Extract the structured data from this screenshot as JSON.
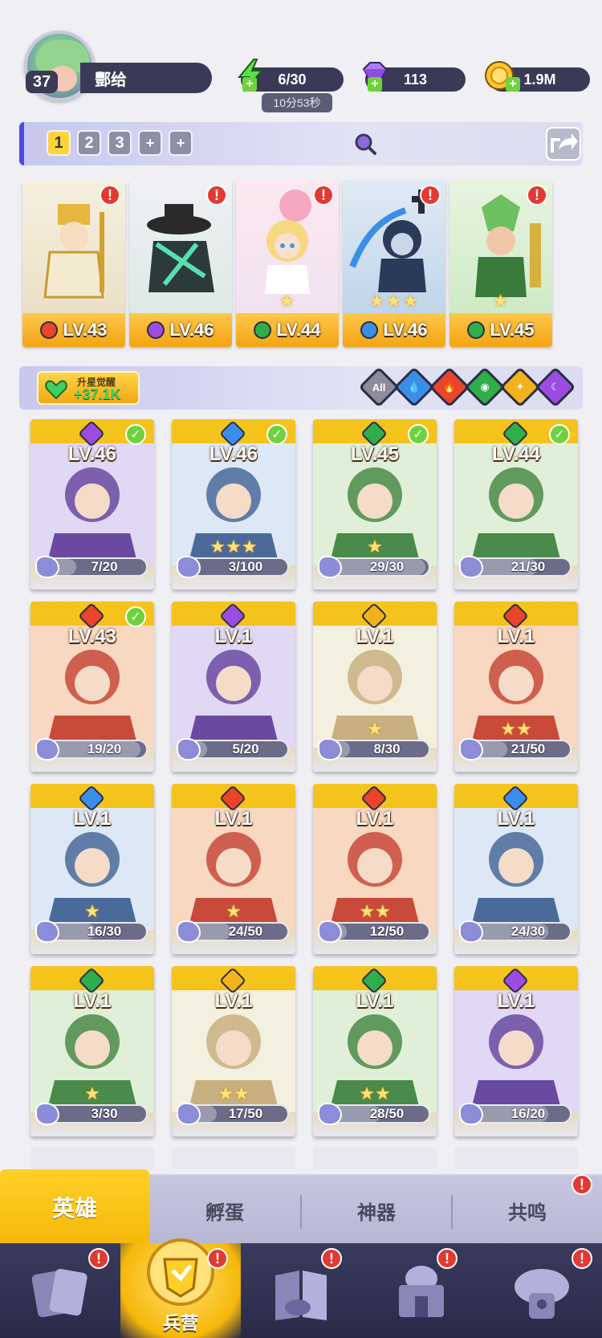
{
  "player": {
    "level": "37",
    "name": "酆给"
  },
  "resources": {
    "energy": {
      "value": "6/30",
      "timer": "10分53秒",
      "icon": "lightning-icon"
    },
    "gems": {
      "value": "113",
      "icon": "gem-icon"
    },
    "coins": {
      "value": "1.9M",
      "icon": "coin-icon"
    }
  },
  "team_tabs": [
    "1",
    "2",
    "3",
    "+",
    "+"
  ],
  "team": [
    {
      "level": "LV.43",
      "element": "fire",
      "alert": "!",
      "stars": ""
    },
    {
      "level": "LV.46",
      "element": "dark",
      "alert": "!",
      "stars": ""
    },
    {
      "level": "LV.44",
      "element": "nature",
      "alert": "!",
      "stars": "★"
    },
    {
      "level": "LV.46",
      "element": "water",
      "alert": "!",
      "stars": "★★★"
    },
    {
      "level": "LV.45",
      "element": "nature",
      "alert": "!",
      "stars": "★"
    }
  ],
  "awaken": {
    "title": "升星觉醒",
    "value": "+37.1K"
  },
  "filters": [
    "All",
    "water",
    "fire",
    "nature",
    "light",
    "dark"
  ],
  "element_colors": {
    "fire": "#e8452a",
    "dark": "#9a4de0",
    "nature": "#2fae4a",
    "water": "#3a8ee8",
    "light": "#f2b21c",
    "all": "#8c8c9c"
  },
  "heroes": [
    {
      "level": "LV.46",
      "element": "dark",
      "progress": "7/20",
      "fill": 0.35,
      "checked": true,
      "stars": ""
    },
    {
      "level": "LV.46",
      "element": "water",
      "progress": "3/100",
      "fill": 0.03,
      "checked": true,
      "stars": "★★★"
    },
    {
      "level": "LV.45",
      "element": "nature",
      "progress": "29/30",
      "fill": 0.97,
      "checked": true,
      "stars": "★"
    },
    {
      "level": "LV.44",
      "element": "nature",
      "progress": "21/30",
      "fill": 0.7,
      "checked": true,
      "stars": ""
    },
    {
      "level": "LV.43",
      "element": "fire",
      "progress": "19/20",
      "fill": 0.95,
      "checked": true,
      "stars": ""
    },
    {
      "level": "LV.1",
      "element": "dark",
      "progress": "5/20",
      "fill": 0.25,
      "checked": false,
      "stars": ""
    },
    {
      "level": "LV.1",
      "element": "light",
      "progress": "8/30",
      "fill": 0.27,
      "checked": false,
      "stars": "★"
    },
    {
      "level": "LV.1",
      "element": "fire",
      "progress": "21/50",
      "fill": 0.42,
      "checked": false,
      "stars": "★★"
    },
    {
      "level": "LV.1",
      "element": "water",
      "progress": "16/30",
      "fill": 0.53,
      "checked": false,
      "stars": "★"
    },
    {
      "level": "LV.1",
      "element": "fire",
      "progress": "24/50",
      "fill": 0.48,
      "checked": false,
      "stars": "★"
    },
    {
      "level": "LV.1",
      "element": "fire",
      "progress": "12/50",
      "fill": 0.24,
      "checked": false,
      "stars": "★★"
    },
    {
      "level": "LV.1",
      "element": "water",
      "progress": "24/30",
      "fill": 0.8,
      "checked": false,
      "stars": ""
    },
    {
      "level": "LV.1",
      "element": "nature",
      "progress": "3/30",
      "fill": 0.1,
      "checked": false,
      "stars": "★"
    },
    {
      "level": "LV.1",
      "element": "light",
      "progress": "17/50",
      "fill": 0.34,
      "checked": false,
      "stars": "★★"
    },
    {
      "level": "LV.1",
      "element": "nature",
      "progress": "28/50",
      "fill": 0.56,
      "checked": false,
      "stars": "★★"
    },
    {
      "level": "LV.1",
      "element": "dark",
      "progress": "16/20",
      "fill": 0.8,
      "checked": false,
      "stars": ""
    }
  ],
  "sub_tabs": [
    "英雄",
    "孵蛋",
    "神器",
    "共鸣"
  ],
  "nav": [
    {
      "icon": "cards-icon",
      "label": "",
      "alert": "!"
    },
    {
      "icon": "barracks-icon",
      "label": "兵营",
      "alert": "!"
    },
    {
      "icon": "book-icon",
      "label": "",
      "alert": "!"
    },
    {
      "icon": "temple-icon",
      "label": "",
      "alert": "!"
    },
    {
      "icon": "mushroom-house-icon",
      "label": "",
      "alert": "!"
    }
  ]
}
